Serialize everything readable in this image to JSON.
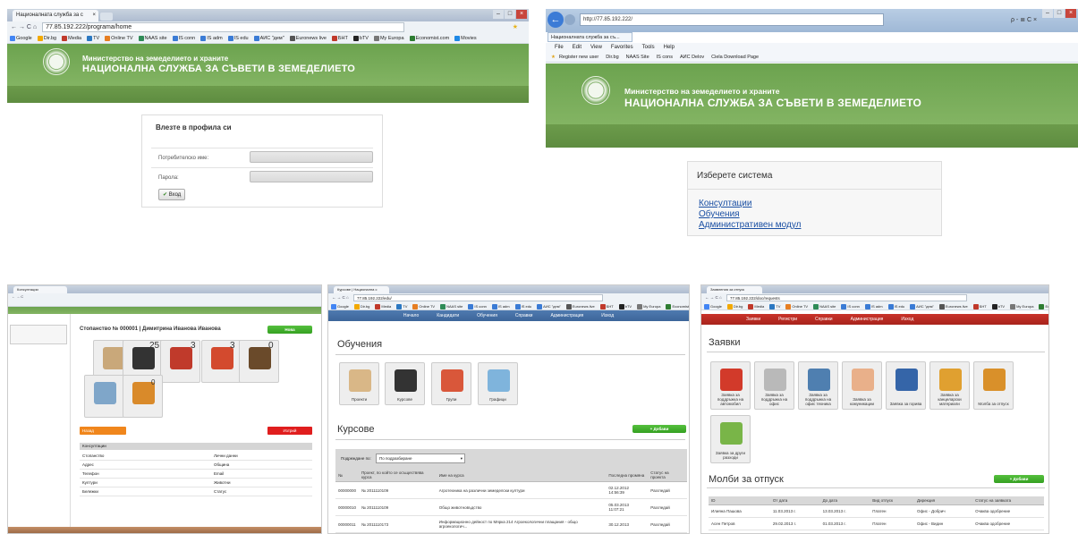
{
  "s1": {
    "tab_title": "Националната служба за с",
    "url": "77.85.192.222/programa/home",
    "bookmarks": [
      "Google",
      "Dir.bg",
      "Media",
      "TV",
      "Online TV",
      "NAAS site",
      "IS conn",
      "IS adm",
      "IS edu",
      "АИС \"дем\"",
      "Euronews live",
      "БНТ",
      "bTV",
      "My Europa",
      "Economist.com",
      "Movies"
    ],
    "header_line1": "Министерство на земеделието и храните",
    "header_line2": "НАЦИОНАЛНА СЛУЖБА ЗА СЪВЕТИ В ЗЕМЕДЕЛИЕТО",
    "login": {
      "title": "Влезте в профила си",
      "username_label": "Потребителско име:",
      "password_label": "Парола:",
      "submit": "Вход"
    }
  },
  "s2": {
    "tab_title": "Националната служба за съ...",
    "url": "http://77.85.192.222/",
    "menu": [
      "File",
      "Edit",
      "View",
      "Favorites",
      "Tools",
      "Help"
    ],
    "favorites": [
      "Register new user",
      "Dir.bg",
      "NAAS Site",
      "IS cons",
      "AИС Delov",
      "Ciela Download Page"
    ],
    "search_icons": "ρ - ≣ C ×",
    "header_line1": "Министерство на земеделието и храните",
    "header_line2": "НАЦИОНАЛНА СЛУЖБА ЗА СЪВЕТИ В ЗЕМЕДЕЛИЕТО",
    "system": {
      "title": "Изберете система",
      "options": [
        "Консултации",
        "Обучения",
        "Административен модул"
      ]
    }
  },
  "s3": {
    "tab_title": "Консултации",
    "title": "Стопанство № 000001 | Димитрина Иванова Иванова",
    "add_btn": "Нова",
    "badges": [
      "25",
      "3",
      "3",
      "0",
      "0"
    ],
    "orange_btn": "Назад",
    "red_btn": "Изтрий",
    "table_title": "Консултации",
    "rows": [
      [
        "Стопанство",
        "Лични данни"
      ],
      [
        "Адрес",
        "Община"
      ],
      [
        "Телефон",
        "Email"
      ],
      [
        "Култури",
        "Животни"
      ],
      [
        "Бележки",
        "Статус"
      ]
    ]
  },
  "s4": {
    "tab_title": "Курсове | Национална с",
    "url": "77.85.192.222/edu/",
    "nav": [
      "Начало",
      "Кандидати",
      "Обучения",
      "Справки",
      "Администрация",
      "Изход"
    ],
    "section1": "Обучения",
    "tiles": [
      "Проекти",
      "Курсове",
      "Групи",
      "Графици"
    ],
    "section2": "Курсове",
    "add_btn": "+ Добави",
    "filter_label": "Подреждане по:",
    "filter_value": "По подразбиране",
    "cols": [
      "№",
      "Проект, по който се осъществява курса",
      "Име на курса",
      "Последна промяна",
      "Статус на проекта"
    ],
    "rows": [
      [
        "00000000",
        "№ 2011110109",
        "Агротехника на различни земеделски култури",
        "02.12.2012 14:56:39",
        "Разгледай"
      ],
      [
        "00000010",
        "№ 2011110109",
        "Общо животновъдство",
        "05.03.2013 11:07:21",
        "Разгледай"
      ],
      [
        "00000011",
        "№ 2011110173",
        "Информационно дейност по Мярка 214 Агроекологични плащания - общо агроекологич...",
        "30.12.2013",
        "Разгледай"
      ]
    ]
  },
  "s5": {
    "tab_title": "Заявления за отпуск",
    "url": "77.85.192.222/doc/requests",
    "nav": [
      "Заявки",
      "Регистри",
      "Справки",
      "Администрация",
      "Изход"
    ],
    "section1": "Заявки",
    "tiles": [
      "Заявка за поддръжка на автомобил",
      "Заявка за поддръжка на офис",
      "Заявка за поддръжка на офис техника",
      "Заявка за комуникации",
      "Заявка за горива",
      "Заявка за канцеларски материали",
      "Молба за отпуск",
      "Заявка за други разходи"
    ],
    "section2": "Молби за отпуск",
    "add_btn": "+ Добави",
    "cols": [
      "ID",
      "От дата",
      "До дата",
      "Вид отпуск",
      "Дирекция",
      "Статус на заявката"
    ],
    "rows": [
      [
        "Илияна Пашова",
        "11.03.2013 г.",
        "13.03.2013 г.",
        "Платен",
        "Офис - Добрич",
        "Очаква одобрение"
      ],
      [
        "Асен Петров",
        "29.02.2013 г.",
        "01.03.2013 г.",
        "Платен",
        "Офис - Видин",
        "Очаква одобрение"
      ]
    ]
  }
}
